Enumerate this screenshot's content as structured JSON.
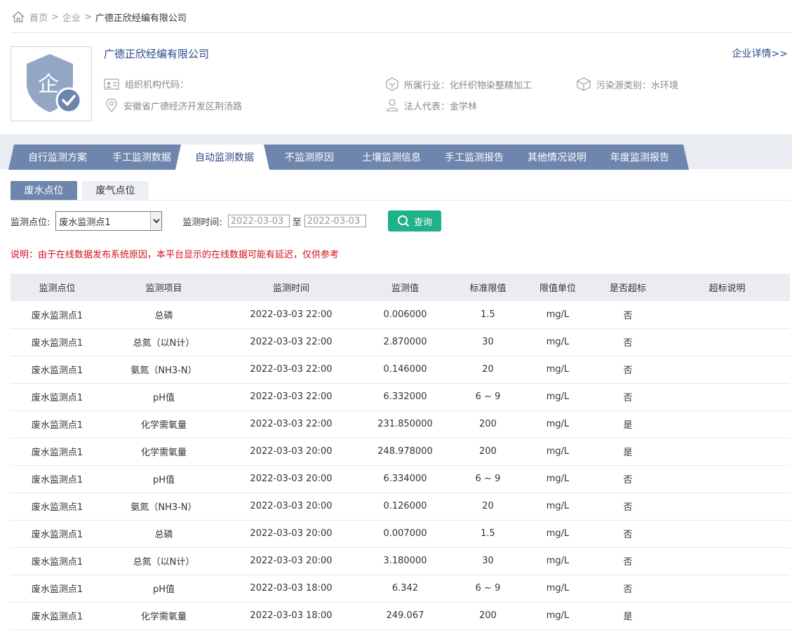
{
  "breadcrumb": {
    "home": "首页",
    "sep1": ">",
    "enterprise": "企业",
    "sep2": ">",
    "current": "广德正欣经编有限公司"
  },
  "company": {
    "name": "广德正欣经编有限公司",
    "detail_link": "企业详情>>",
    "org_code_label": "组织机构代码：",
    "industry": "所属行业：化纤织物染整精加工",
    "pollution_type": "污染源类别：水环境",
    "address": "安徽省广德经济开发区荆汤路",
    "legal_rep": "法人代表：金学林"
  },
  "tabs": [
    {
      "label": "自行监测方案",
      "active": false
    },
    {
      "label": "手工监测数据",
      "active": false
    },
    {
      "label": "自动监测数据",
      "active": true
    },
    {
      "label": "不监测原因",
      "active": false
    },
    {
      "label": "土壤监测信息",
      "active": false
    },
    {
      "label": "手工监测报告",
      "active": false
    },
    {
      "label": "其他情况说明",
      "active": false
    },
    {
      "label": "年度监测报告",
      "active": false
    }
  ],
  "subtabs": [
    {
      "label": "废水点位",
      "active": true
    },
    {
      "label": "废气点位",
      "active": false
    }
  ],
  "filters": {
    "point_label": "监测点位:",
    "point_value": "废水监测点1",
    "time_label": "监测时间:",
    "date_from": "2022-03-03",
    "to_label": "至",
    "date_to": "2022-03-03",
    "query_label": "查询"
  },
  "notice": "说明：由于在线数据发布系统原因，本平台显示的在线数据可能有延迟，仅供参考",
  "table": {
    "headers": [
      "监测点位",
      "监测项目",
      "监测时间",
      "监测值",
      "标准限值",
      "限值单位",
      "是否超标",
      "超标说明"
    ],
    "rows": [
      [
        "废水监测点1",
        "总磷",
        "2022-03-03 22:00",
        "0.006000",
        "1.5",
        "mg/L",
        "否",
        ""
      ],
      [
        "废水监测点1",
        "总氮（以N计）",
        "2022-03-03 22:00",
        "2.870000",
        "30",
        "mg/L",
        "否",
        ""
      ],
      [
        "废水监测点1",
        "氨氮（NH3-N）",
        "2022-03-03 22:00",
        "0.146000",
        "20",
        "mg/L",
        "否",
        ""
      ],
      [
        "废水监测点1",
        "pH值",
        "2022-03-03 22:00",
        "6.332000",
        "6 ~ 9",
        "mg/L",
        "否",
        ""
      ],
      [
        "废水监测点1",
        "化学需氧量",
        "2022-03-03 22:00",
        "231.850000",
        "200",
        "mg/L",
        "是",
        ""
      ],
      [
        "废水监测点1",
        "化学需氧量",
        "2022-03-03 20:00",
        "248.978000",
        "200",
        "mg/L",
        "是",
        ""
      ],
      [
        "废水监测点1",
        "pH值",
        "2022-03-03 20:00",
        "6.334000",
        "6 ~ 9",
        "mg/L",
        "否",
        ""
      ],
      [
        "废水监测点1",
        "氨氮（NH3-N）",
        "2022-03-03 20:00",
        "0.126000",
        "20",
        "mg/L",
        "否",
        ""
      ],
      [
        "废水监测点1",
        "总磷",
        "2022-03-03 20:00",
        "0.007000",
        "1.5",
        "mg/L",
        "否",
        ""
      ],
      [
        "废水监测点1",
        "总氮（以N计）",
        "2022-03-03 20:00",
        "3.180000",
        "30",
        "mg/L",
        "否",
        ""
      ],
      [
        "废水监测点1",
        "pH值",
        "2022-03-03 18:00",
        "6.342",
        "6 ~ 9",
        "mg/L",
        "否",
        ""
      ],
      [
        "废水监测点1",
        "化学需氧量",
        "2022-03-03 18:00",
        "249.067",
        "200",
        "mg/L",
        "是",
        ""
      ]
    ]
  },
  "colors": {
    "tab_bg": "#6e86ad",
    "brand_text": "#2b4a8a",
    "query_btn": "#1fb189",
    "notice": "#d0121b"
  },
  "icons": [
    "home-icon",
    "company-logo-icon",
    "id-card-icon",
    "location-icon",
    "industry-icon",
    "person-icon",
    "cube-icon",
    "chevron-down-icon",
    "search-icon"
  ]
}
